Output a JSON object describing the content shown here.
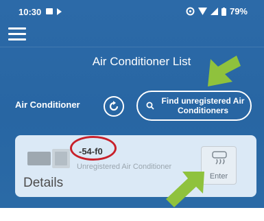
{
  "status_bar": {
    "time": "10:30",
    "battery": "79%"
  },
  "header": {
    "title": "Air Conditioner List"
  },
  "toolbar": {
    "section_label": "Air Conditioner",
    "find_button_label": "Find unregistered Air Conditioners"
  },
  "device_card": {
    "name": "-54-f0",
    "status": "Unregistered Air Conditioner",
    "details_label": "Details",
    "enter_label": "Enter"
  },
  "colors": {
    "app_background": "#2a68a6",
    "card_background": "#dbe9f6",
    "highlight_ring": "#c8202a",
    "pointer_arrow": "#8fc23d"
  },
  "icons": {
    "menu": "hamburger-icon",
    "refresh": "refresh-icon",
    "search": "search-icon",
    "unit": "air-conditioner-unit-icon",
    "enter": "indoor-unit-icon"
  }
}
